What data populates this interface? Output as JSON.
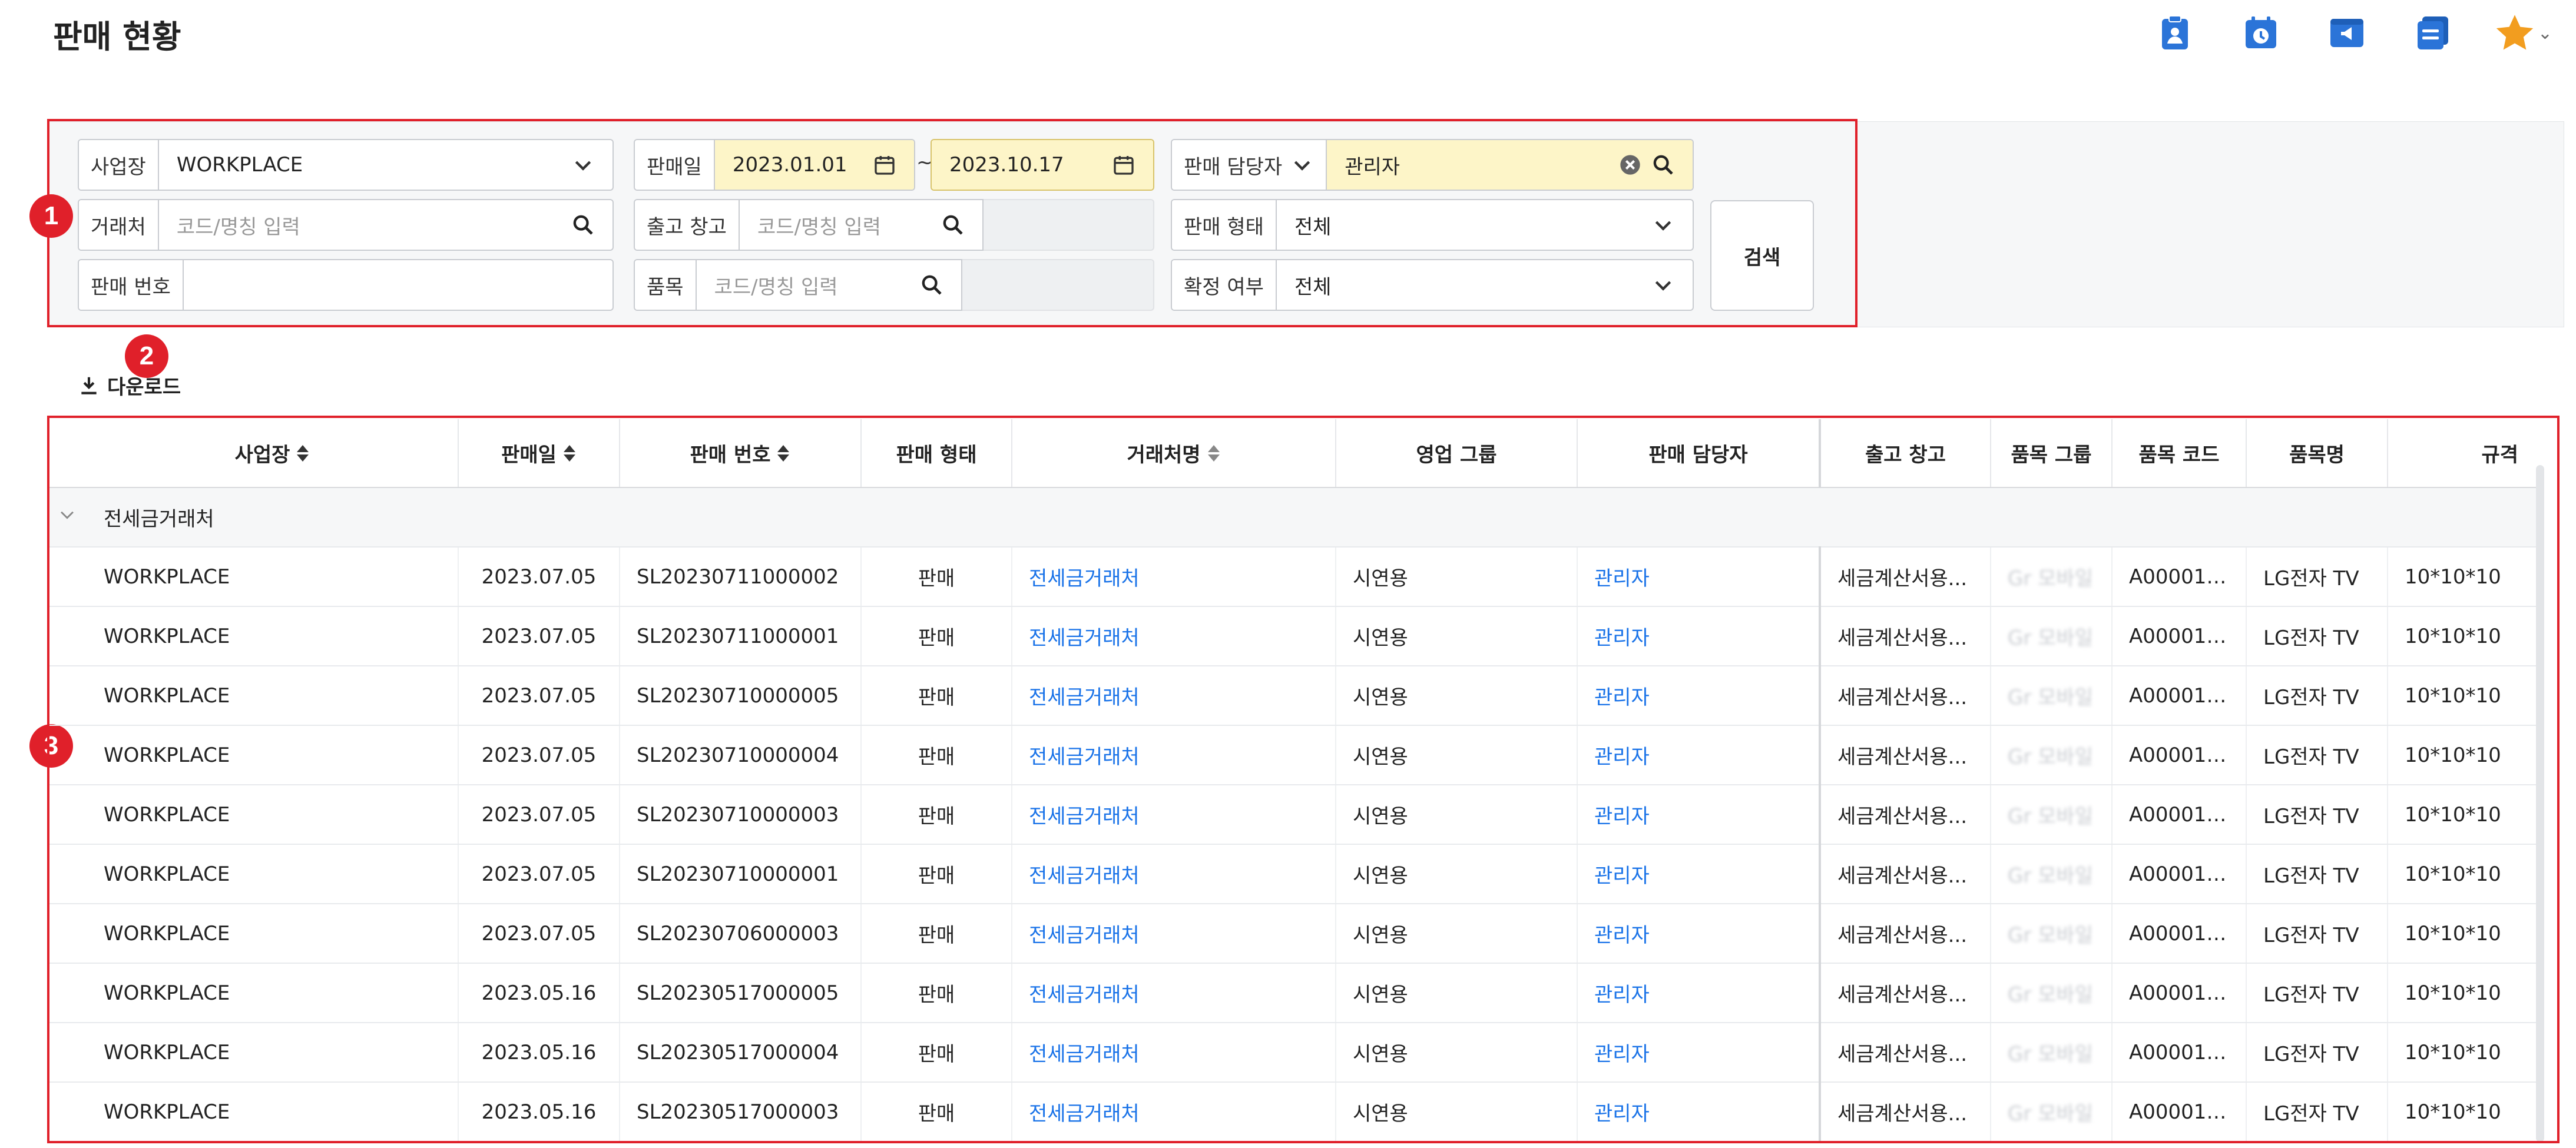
{
  "page": {
    "title": "판매 현황"
  },
  "top_icons": [
    "clipboard-user-icon",
    "calendar-clock-icon",
    "megaphone-window-icon",
    "document-list-icon",
    "star-icon"
  ],
  "colors": {
    "highlight": "#e0202a",
    "link": "#1a73e8",
    "yellow_field": "#fdf5c8",
    "icon_blue": "#2b74d8",
    "star": "#f29d1f"
  },
  "badges": {
    "b1": "1",
    "b2": "2",
    "b3": "3"
  },
  "search": {
    "workplace": {
      "label": "사업장",
      "value": "WORKPLACE"
    },
    "sale_date": {
      "label": "판매일",
      "from": "2023.01.01",
      "to": "2023.10.17",
      "sep": "~"
    },
    "manager": {
      "label": "판매 담당자",
      "value": "관리자"
    },
    "customer": {
      "label": "거래처",
      "placeholder": "코드/명칭 입력"
    },
    "warehouse": {
      "label": "출고 창고",
      "placeholder": "코드/명칭 입력"
    },
    "sale_type": {
      "label": "판매 형태",
      "value": "전체"
    },
    "sale_no": {
      "label": "판매 번호",
      "value": ""
    },
    "item": {
      "label": "품목",
      "placeholder": "코드/명칭 입력"
    },
    "confirm": {
      "label": "확정 여부",
      "value": "전체"
    },
    "search_button": "검색"
  },
  "download_label": "다운로드",
  "table": {
    "columns": [
      "사업장",
      "판매일",
      "판매 번호",
      "판매 형태",
      "거래처명",
      "영업 그룹",
      "판매 담당자",
      "출고 창고",
      "품목 그룹",
      "품목 코드",
      "품목명",
      "규격"
    ],
    "group_label": "전세금거래처",
    "rows": [
      [
        "WORKPLACE",
        "2023.07.05",
        "SL20230711000002",
        "판매",
        "전세금거래처",
        "시연용",
        "관리자",
        "세금계산서용...",
        "Gr 모바일",
        "A000010...",
        "LG전자 TV",
        "10*10*10"
      ],
      [
        "WORKPLACE",
        "2023.07.05",
        "SL20230711000001",
        "판매",
        "전세금거래처",
        "시연용",
        "관리자",
        "세금계산서용...",
        "Gr 모바일",
        "A000010...",
        "LG전자 TV",
        "10*10*10"
      ],
      [
        "WORKPLACE",
        "2023.07.05",
        "SL20230710000005",
        "판매",
        "전세금거래처",
        "시연용",
        "관리자",
        "세금계산서용...",
        "Gr 모바일",
        "A000010...",
        "LG전자 TV",
        "10*10*10"
      ],
      [
        "WORKPLACE",
        "2023.07.05",
        "SL20230710000004",
        "판매",
        "전세금거래처",
        "시연용",
        "관리자",
        "세금계산서용...",
        "Gr 모바일",
        "A000010...",
        "LG전자 TV",
        "10*10*10"
      ],
      [
        "WORKPLACE",
        "2023.07.05",
        "SL20230710000003",
        "판매",
        "전세금거래처",
        "시연용",
        "관리자",
        "세금계산서용...",
        "Gr 모바일",
        "A000010...",
        "LG전자 TV",
        "10*10*10"
      ],
      [
        "WORKPLACE",
        "2023.07.05",
        "SL20230710000001",
        "판매",
        "전세금거래처",
        "시연용",
        "관리자",
        "세금계산서용...",
        "Gr 모바일",
        "A000010...",
        "LG전자 TV",
        "10*10*10"
      ],
      [
        "WORKPLACE",
        "2023.07.05",
        "SL20230706000003",
        "판매",
        "전세금거래처",
        "시연용",
        "관리자",
        "세금계산서용...",
        "Gr 모바일",
        "A000010...",
        "LG전자 TV",
        "10*10*10"
      ],
      [
        "WORKPLACE",
        "2023.05.16",
        "SL20230517000005",
        "판매",
        "전세금거래처",
        "시연용",
        "관리자",
        "세금계산서용...",
        "Gr 모바일",
        "A000010...",
        "LG전자 TV",
        "10*10*10"
      ],
      [
        "WORKPLACE",
        "2023.05.16",
        "SL20230517000004",
        "판매",
        "전세금거래처",
        "시연용",
        "관리자",
        "세금계산서용...",
        "Gr 모바일",
        "A000010...",
        "LG전자 TV",
        "10*10*10"
      ],
      [
        "WORKPLACE",
        "2023.05.16",
        "SL20230517000003",
        "판매",
        "전세금거래처",
        "시연용",
        "관리자",
        "세금계산서용...",
        "Gr 모바일",
        "A000010...",
        "LG전자 TV",
        "10*10*10"
      ]
    ]
  }
}
